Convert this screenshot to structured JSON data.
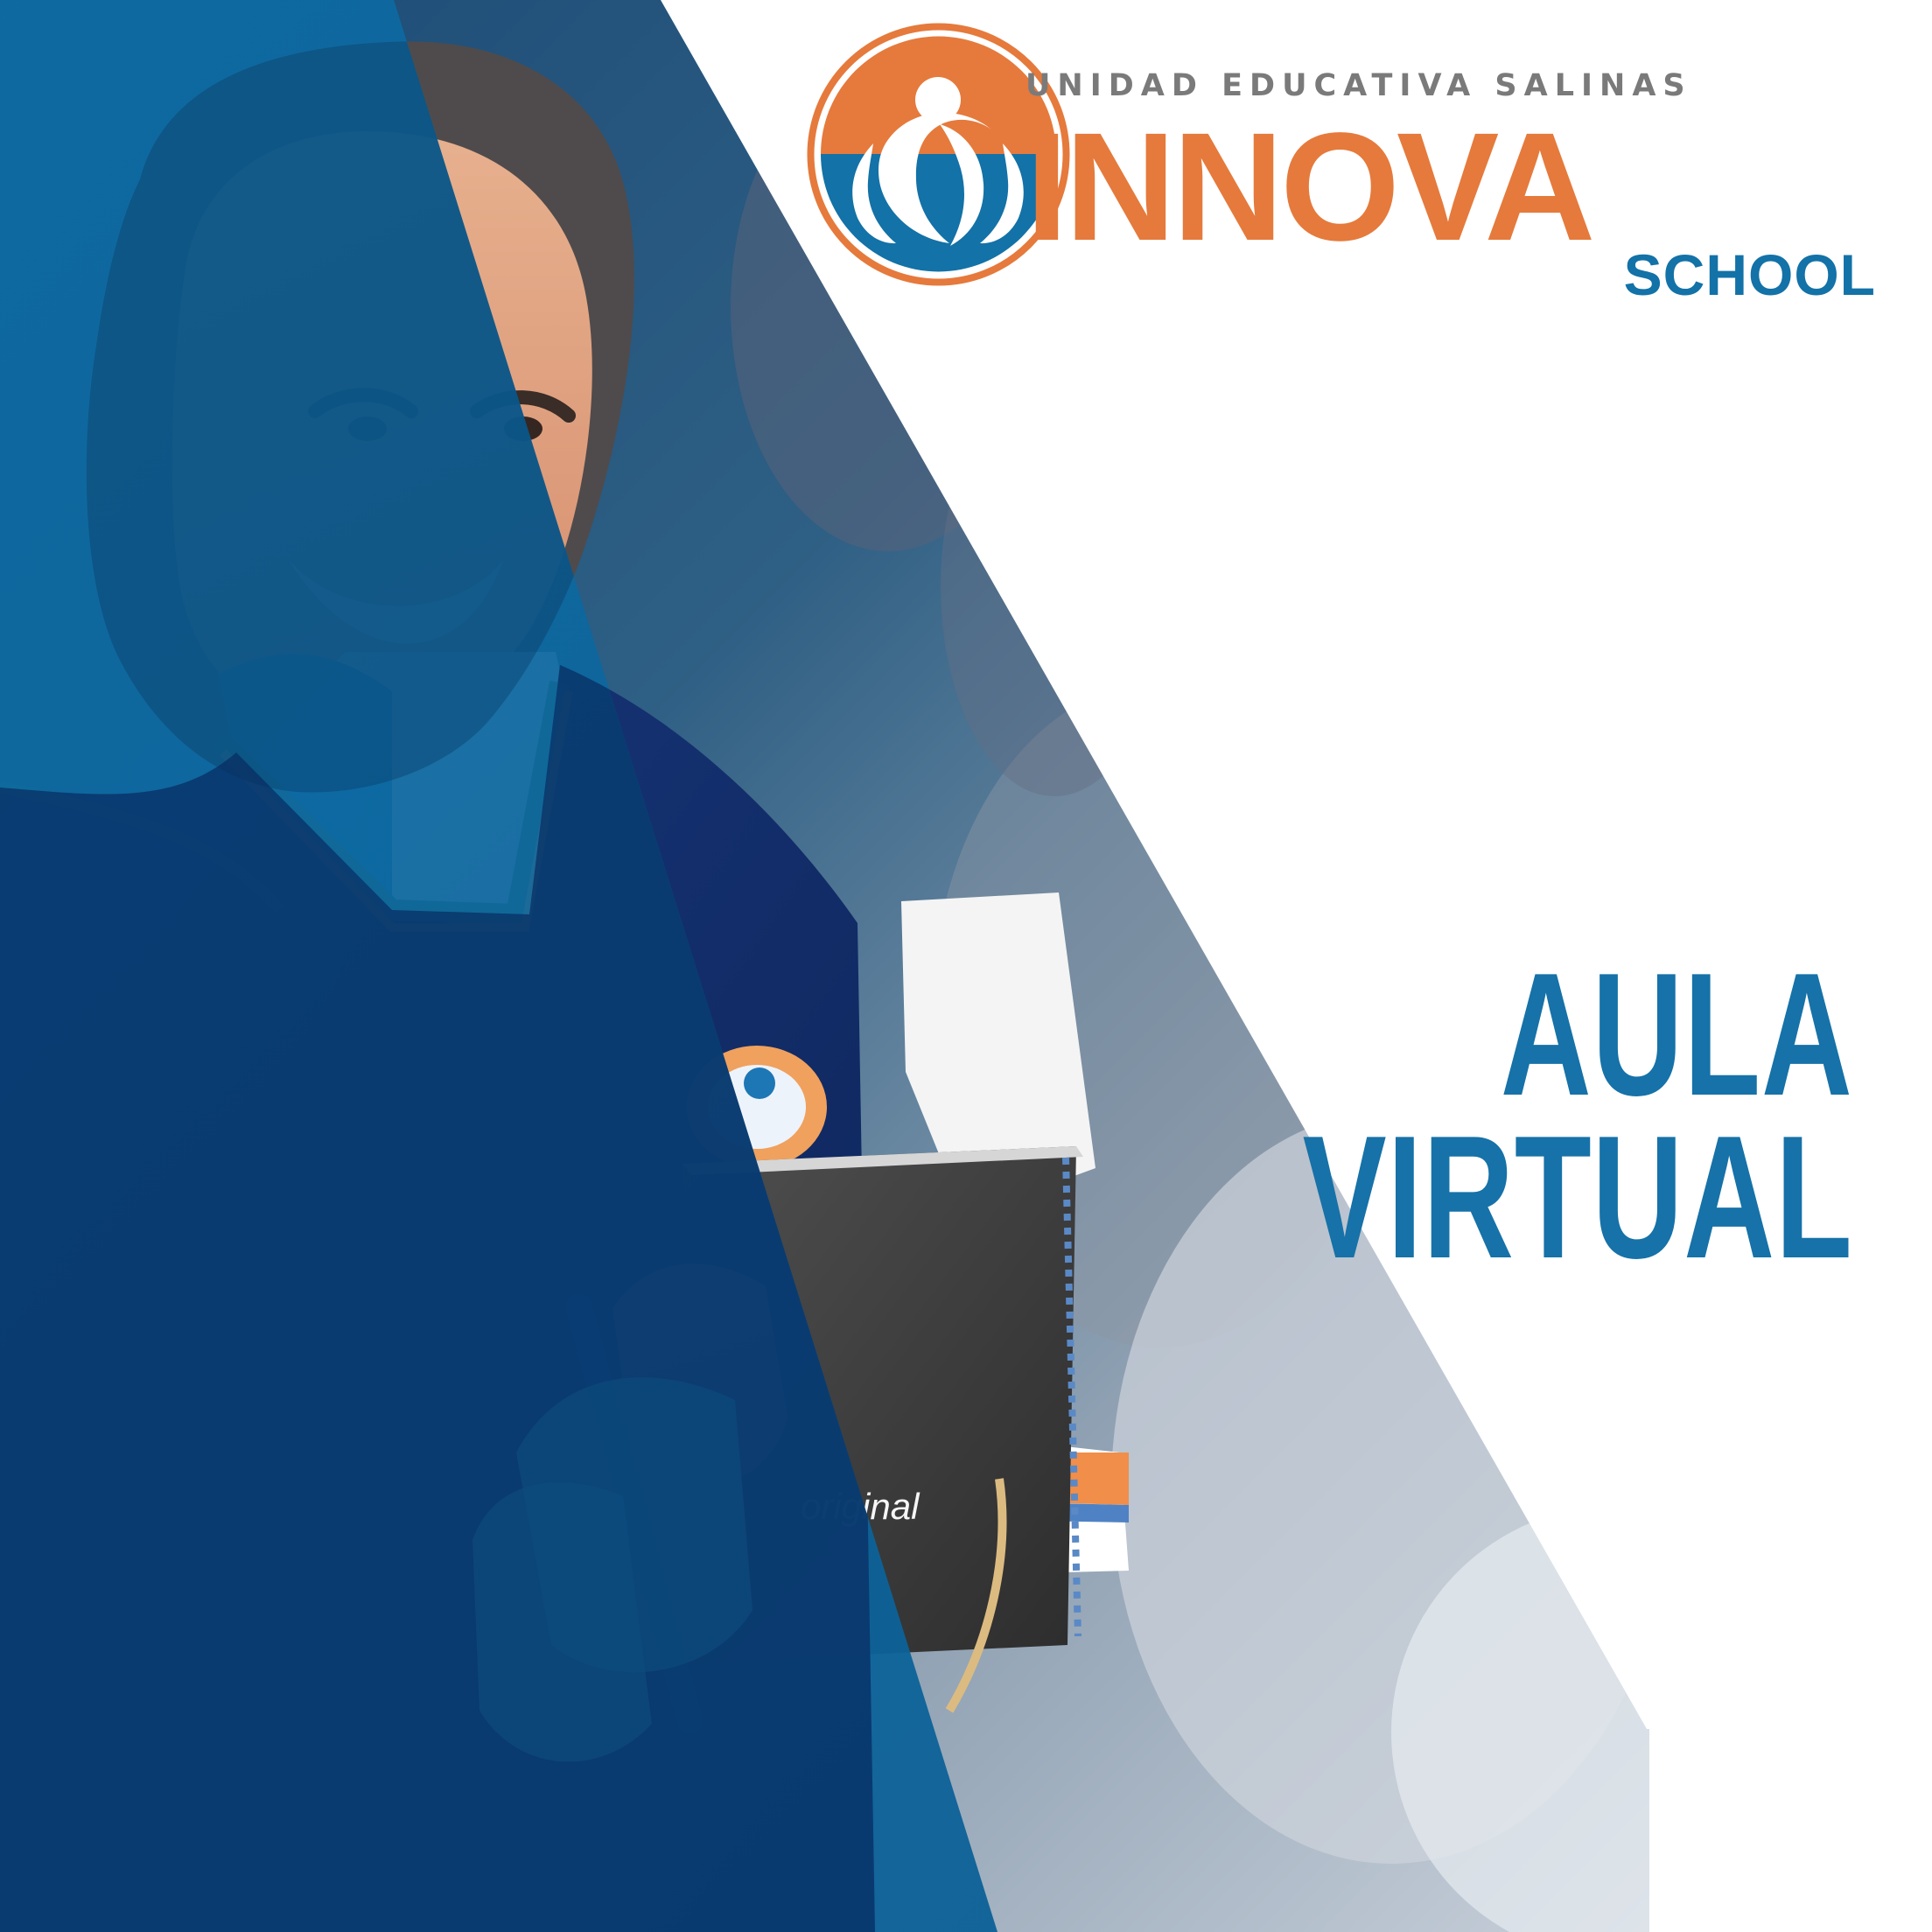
{
  "brand": {
    "top_label": "UNIDAD EDUCATIVA SALINAS",
    "main_label": "INNOVA",
    "sub_label": "SCHOOL"
  },
  "headline": {
    "line1": "AULA",
    "line2": "VIRTUAL"
  },
  "colors": {
    "orange": "#e57a3c",
    "blue": "#1372a7",
    "navy": "#0f2d6e",
    "gray": "#7a7a7a"
  },
  "icons": {
    "logo": "innova-school-logo-icon",
    "person": "student-photo"
  }
}
